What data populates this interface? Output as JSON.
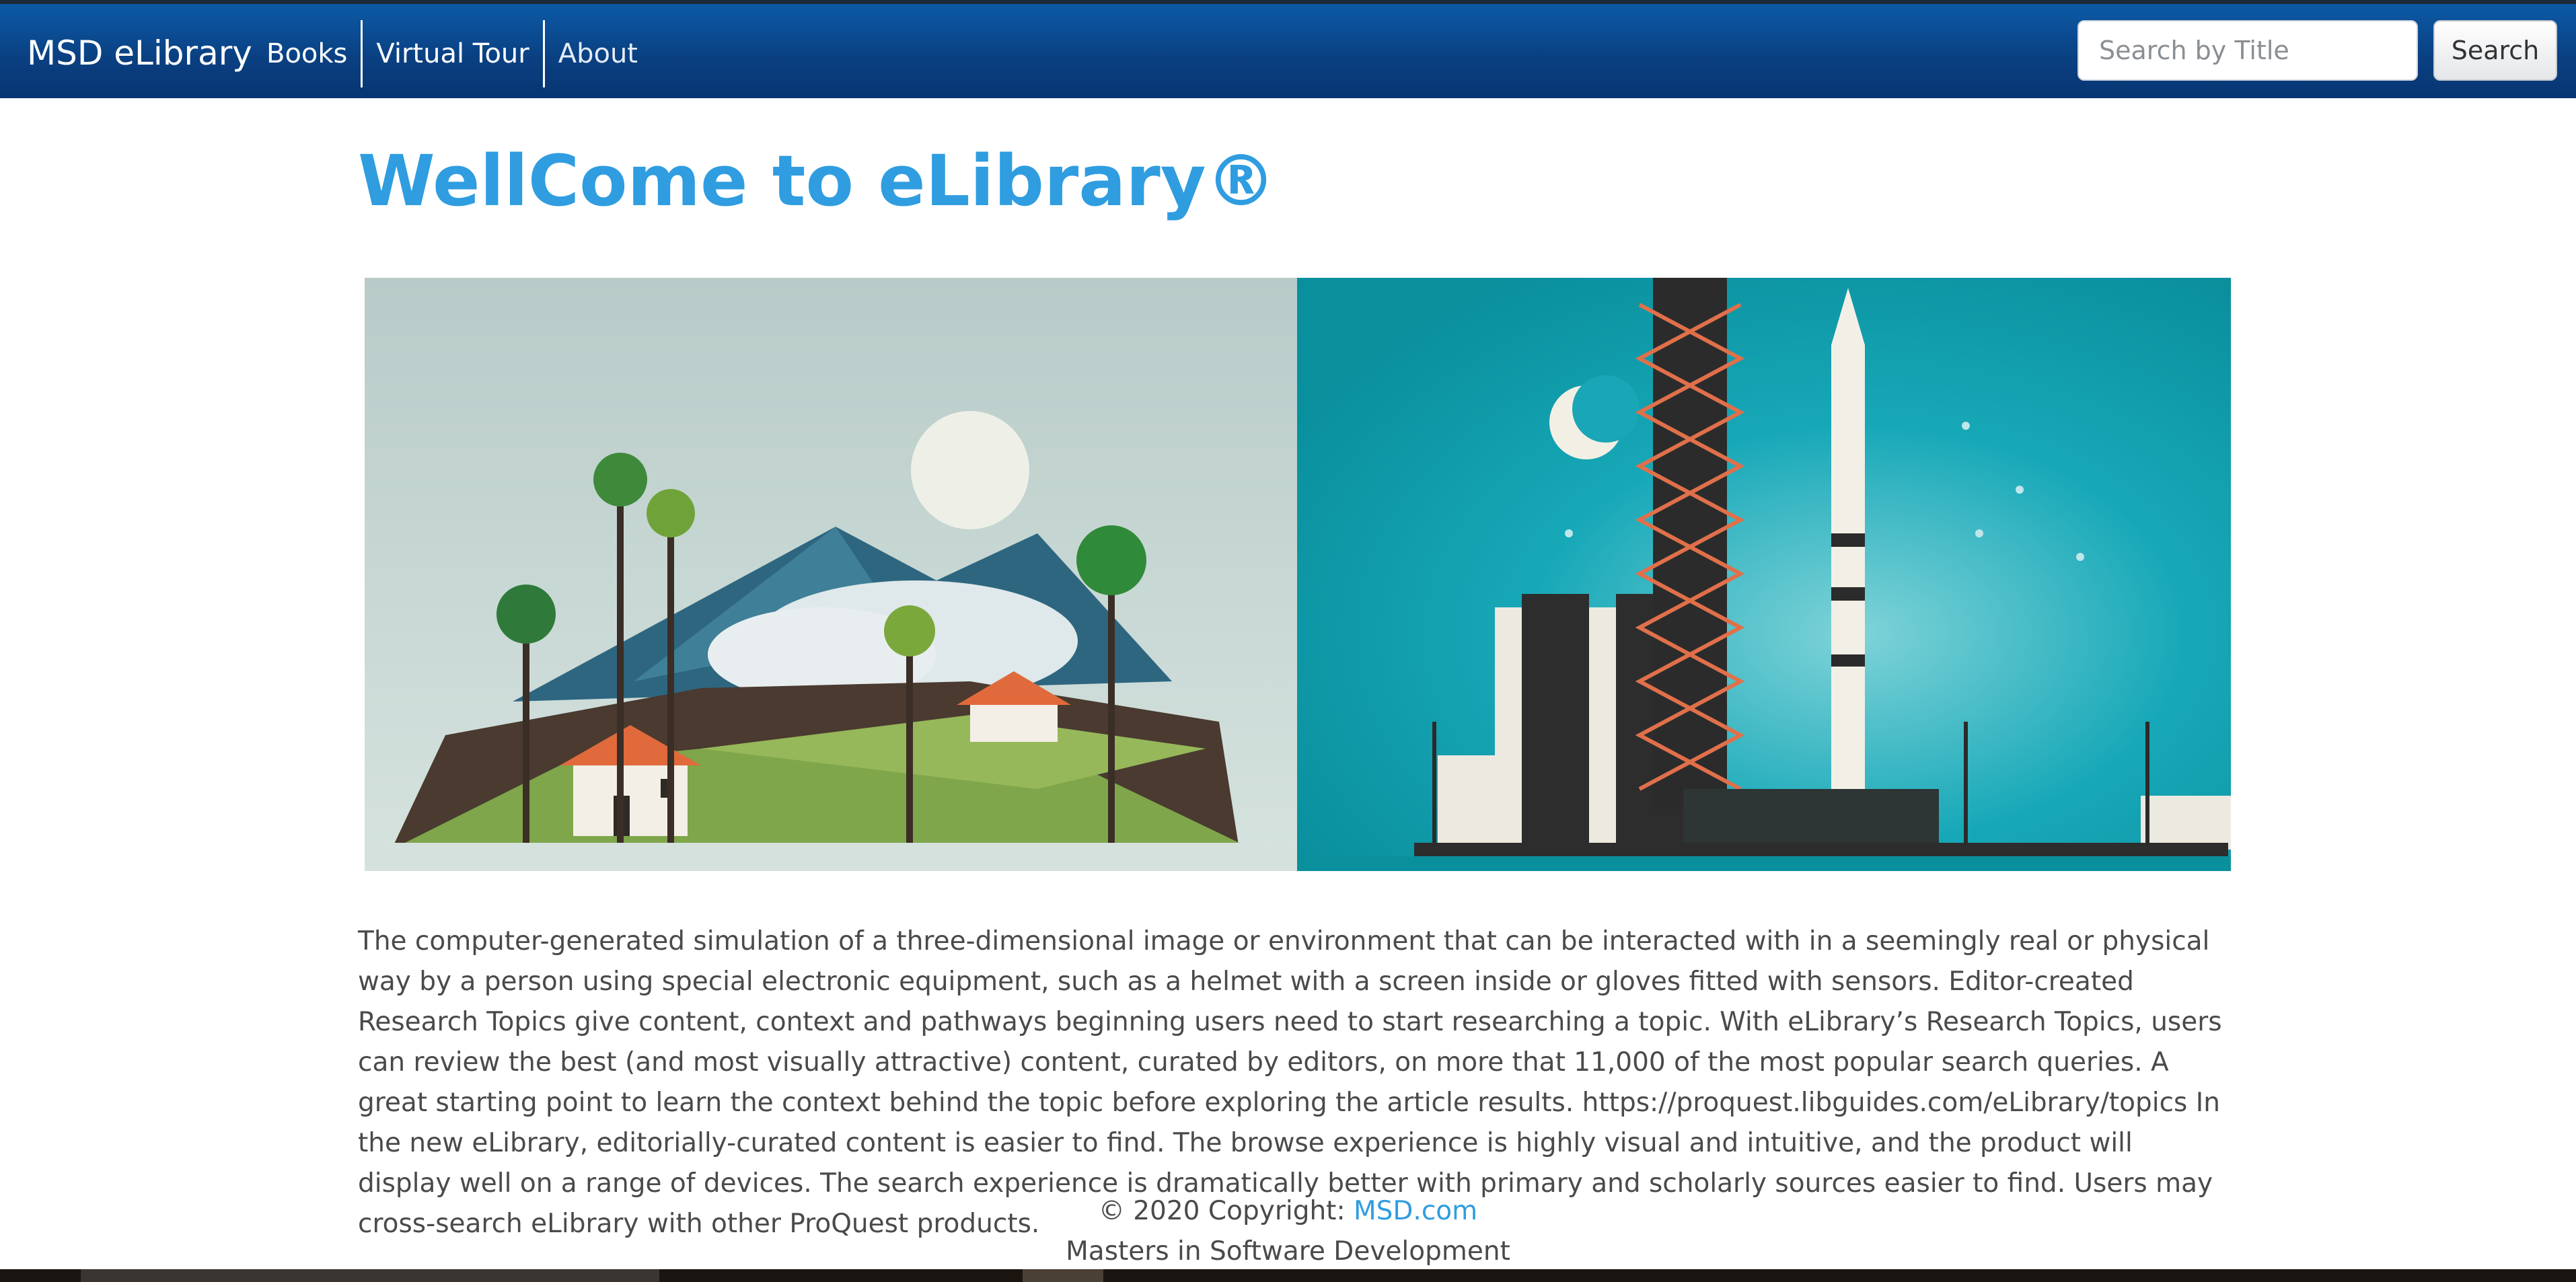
{
  "navbar": {
    "brand": "MSD eLibrary",
    "links": [
      "Books",
      "Virtual Tour",
      "About"
    ],
    "search_placeholder": "Search by Title",
    "search_button": "Search"
  },
  "main": {
    "title": "WellCome to eLibrary®",
    "hero_image": "tropical-village-and-rocket-launch-illustration",
    "paragraph": "The computer-generated simulation of a three-dimensional image or environment that can be interacted with in a seemingly real or physical way by a person using special electronic equipment, such as a helmet with a screen inside or gloves fitted with sensors. Editor-created Research Topics give content, context and pathways beginning users need to start researching a topic. With eLibrary’s Research Topics, users can review the best (and most visually attractive) content, curated by editors, on more that 11,000 of the most popular search queries. A great starting point to learn the context behind the topic before exploring the article results. https://proquest.libguides.com/eLibrary/topics In the new eLibrary, editorially-curated content is easier to find. The browse experience is highly visual and intuitive, and the product will display well on a range of devices. The search experience is dramatically better with primary and scholarly sources easier to find. Users may cross-search eLibrary with other ProQuest products."
  },
  "footer": {
    "copyright_prefix": "© 2020 Copyright: ",
    "copyright_link": "MSD.com",
    "tagline": "Masters in Software Development"
  },
  "colors": {
    "navbar": "#0a3f80",
    "title": "#2f9de0",
    "link": "#2f9de0"
  }
}
